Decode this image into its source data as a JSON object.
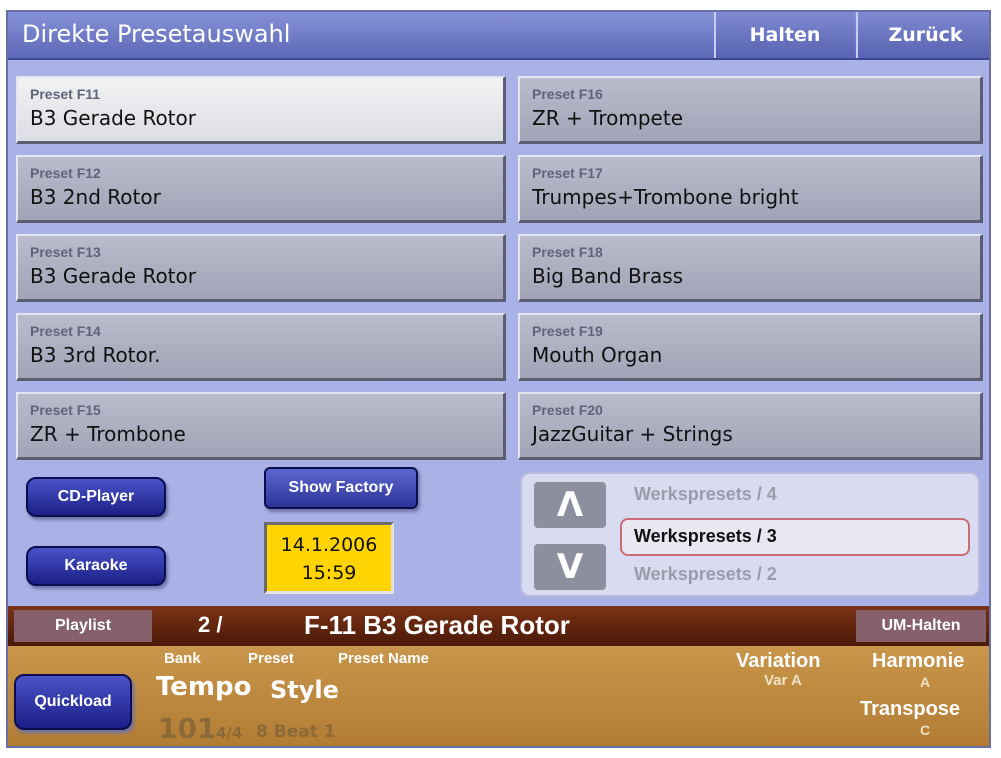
{
  "header": {
    "title": "Direkte Presetauswahl",
    "hold_label": "Halten",
    "back_label": "Zurück"
  },
  "presets": [
    {
      "label": "Preset F11",
      "name": "B3 Gerade Rotor",
      "selected": true
    },
    {
      "label": "Preset F12",
      "name": "B3 2nd Rotor"
    },
    {
      "label": "Preset F13",
      "name": "B3 Gerade Rotor"
    },
    {
      "label": "Preset F14",
      "name": "B3 3rd Rotor."
    },
    {
      "label": "Preset F15",
      "name": "ZR + Trombone"
    },
    {
      "label": "Preset F16",
      "name": "ZR + Trompete"
    },
    {
      "label": "Preset F17",
      "name": "Trumpes+Trombone bright"
    },
    {
      "label": "Preset F18",
      "name": "Big Band Brass"
    },
    {
      "label": "Preset F19",
      "name": "Mouth Organ"
    },
    {
      "label": "Preset F20",
      "name": "JazzGuitar + Strings"
    }
  ],
  "controls": {
    "cd_player": "CD-Player",
    "karaoke": "Karaoke",
    "show_factory": "Show Factory",
    "date": "14.1.2006",
    "time": "15:59"
  },
  "werkspresets": {
    "up_icon": "Λ",
    "down_icon": "V",
    "items": [
      "Werkspresets / 4",
      "Werkspresets / 3",
      "Werkspresets / 2"
    ],
    "selected_index": 1
  },
  "playlist": {
    "label": "Playlist",
    "number": "2 /",
    "title": "F-11 B3 Gerade Rotor",
    "um_halten": "UM-Halten"
  },
  "info": {
    "quickload": "Quickload",
    "bank_hdr": "Bank",
    "preset_hdr": "Preset",
    "preset_name_hdr": "Preset Name",
    "tempo_label": "Tempo",
    "style_label": "Style",
    "tempo_value": "101",
    "time_signature": "4/4",
    "style_value": "8 Beat 1",
    "variation_label": "Variation",
    "variation_value": "Var A",
    "harmonie_label": "Harmonie",
    "harmonie_value": "A",
    "transpose_label": "Transpose",
    "transpose_value": "C"
  },
  "colors": {
    "background": "#a9b1e6",
    "title_bar": "#5d68b8",
    "date_box": "#ffd400",
    "playlist_bar": "#4a1908",
    "info_bar": "#c9964b"
  }
}
